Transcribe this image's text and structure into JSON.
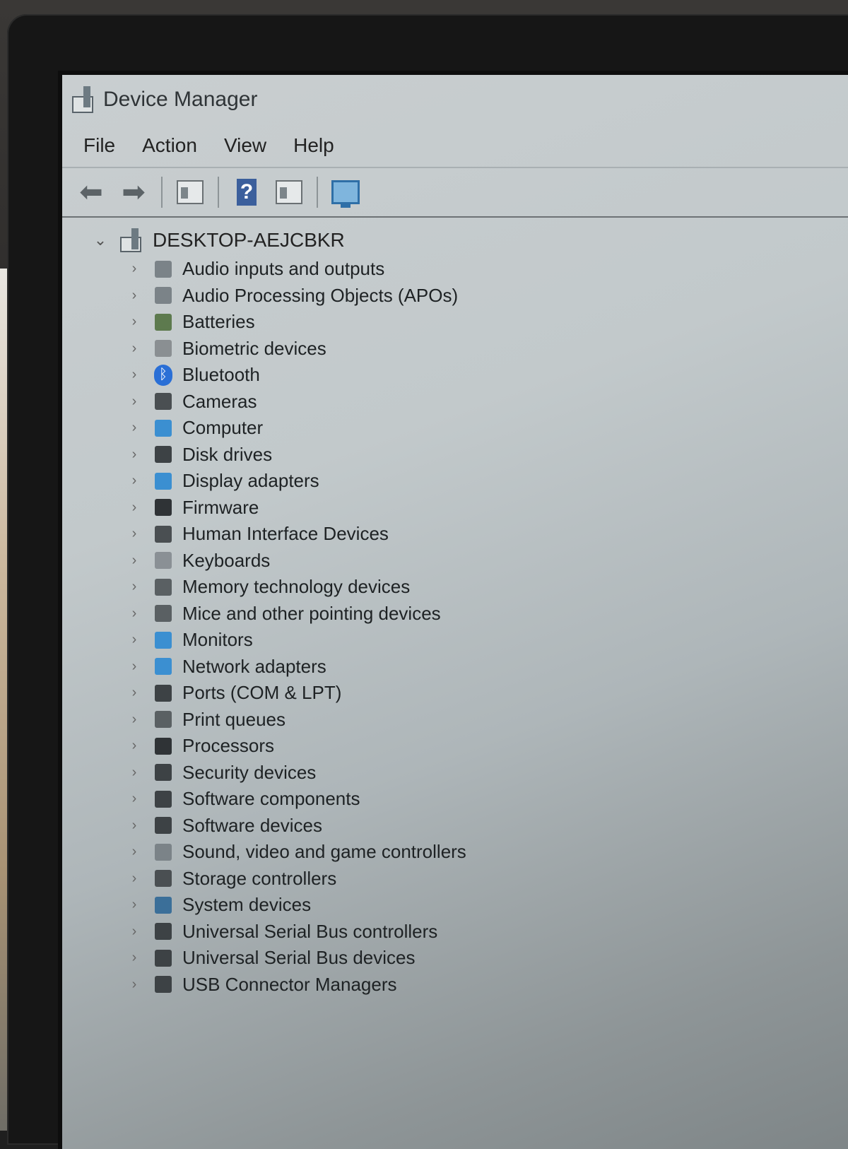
{
  "window": {
    "title": "Device Manager"
  },
  "menu": [
    "File",
    "Action",
    "View",
    "Help"
  ],
  "toolbar": {
    "buttons": [
      "back-arrow-icon",
      "forward-arrow-icon",
      "show-hide-console-tree-icon",
      "help-icon",
      "properties-icon",
      "scan-hardware-icon"
    ]
  },
  "tree": {
    "root": "DESKTOP-AEJCBKR",
    "categories": [
      {
        "label": "Audio inputs and outputs",
        "icon": "speaker-icon",
        "color": "#7b8388"
      },
      {
        "label": "Audio Processing Objects (APOs)",
        "icon": "speaker-icon",
        "color": "#7b8388"
      },
      {
        "label": "Batteries",
        "icon": "battery-icon",
        "color": "#5d7a4e"
      },
      {
        "label": "Biometric devices",
        "icon": "fingerprint-icon",
        "color": "#8a8f92"
      },
      {
        "label": "Bluetooth",
        "icon": "bluetooth-icon",
        "color": "#2a6fd6"
      },
      {
        "label": "Cameras",
        "icon": "camera-icon",
        "color": "#4a4f52"
      },
      {
        "label": "Computer",
        "icon": "computer-icon",
        "color": "#3b8fd1"
      },
      {
        "label": "Disk drives",
        "icon": "disk-drive-icon",
        "color": "#3d4245"
      },
      {
        "label": "Display adapters",
        "icon": "display-adapter-icon",
        "color": "#3b8fd1"
      },
      {
        "label": "Firmware",
        "icon": "firmware-icon",
        "color": "#2f3336"
      },
      {
        "label": "Human Interface Devices",
        "icon": "hid-icon",
        "color": "#4a4f52"
      },
      {
        "label": "Keyboards",
        "icon": "keyboard-icon",
        "color": "#8a9095"
      },
      {
        "label": "Memory technology devices",
        "icon": "memory-icon",
        "color": "#5a6063"
      },
      {
        "label": "Mice and other pointing devices",
        "icon": "mouse-icon",
        "color": "#5a6063"
      },
      {
        "label": "Monitors",
        "icon": "monitor-icon",
        "color": "#3b8fd1"
      },
      {
        "label": "Network adapters",
        "icon": "network-icon",
        "color": "#3b8fd1"
      },
      {
        "label": "Ports (COM & LPT)",
        "icon": "port-icon",
        "color": "#3d4245"
      },
      {
        "label": "Print queues",
        "icon": "printer-icon",
        "color": "#5a6063"
      },
      {
        "label": "Processors",
        "icon": "processor-icon",
        "color": "#2f3336"
      },
      {
        "label": "Security devices",
        "icon": "security-icon",
        "color": "#3d4245"
      },
      {
        "label": "Software components",
        "icon": "software-component-icon",
        "color": "#3d4245"
      },
      {
        "label": "Software devices",
        "icon": "software-device-icon",
        "color": "#3d4245"
      },
      {
        "label": "Sound, video and game controllers",
        "icon": "speaker-icon",
        "color": "#7b8388"
      },
      {
        "label": "Storage controllers",
        "icon": "storage-controller-icon",
        "color": "#4a4f52"
      },
      {
        "label": "System devices",
        "icon": "system-devices-icon",
        "color": "#3b6f99"
      },
      {
        "label": "Universal Serial Bus controllers",
        "icon": "usb-icon",
        "color": "#3d4245"
      },
      {
        "label": "Universal Serial Bus devices",
        "icon": "usb-icon",
        "color": "#3d4245"
      },
      {
        "label": "USB Connector Managers",
        "icon": "usb-icon",
        "color": "#3d4245"
      }
    ]
  }
}
